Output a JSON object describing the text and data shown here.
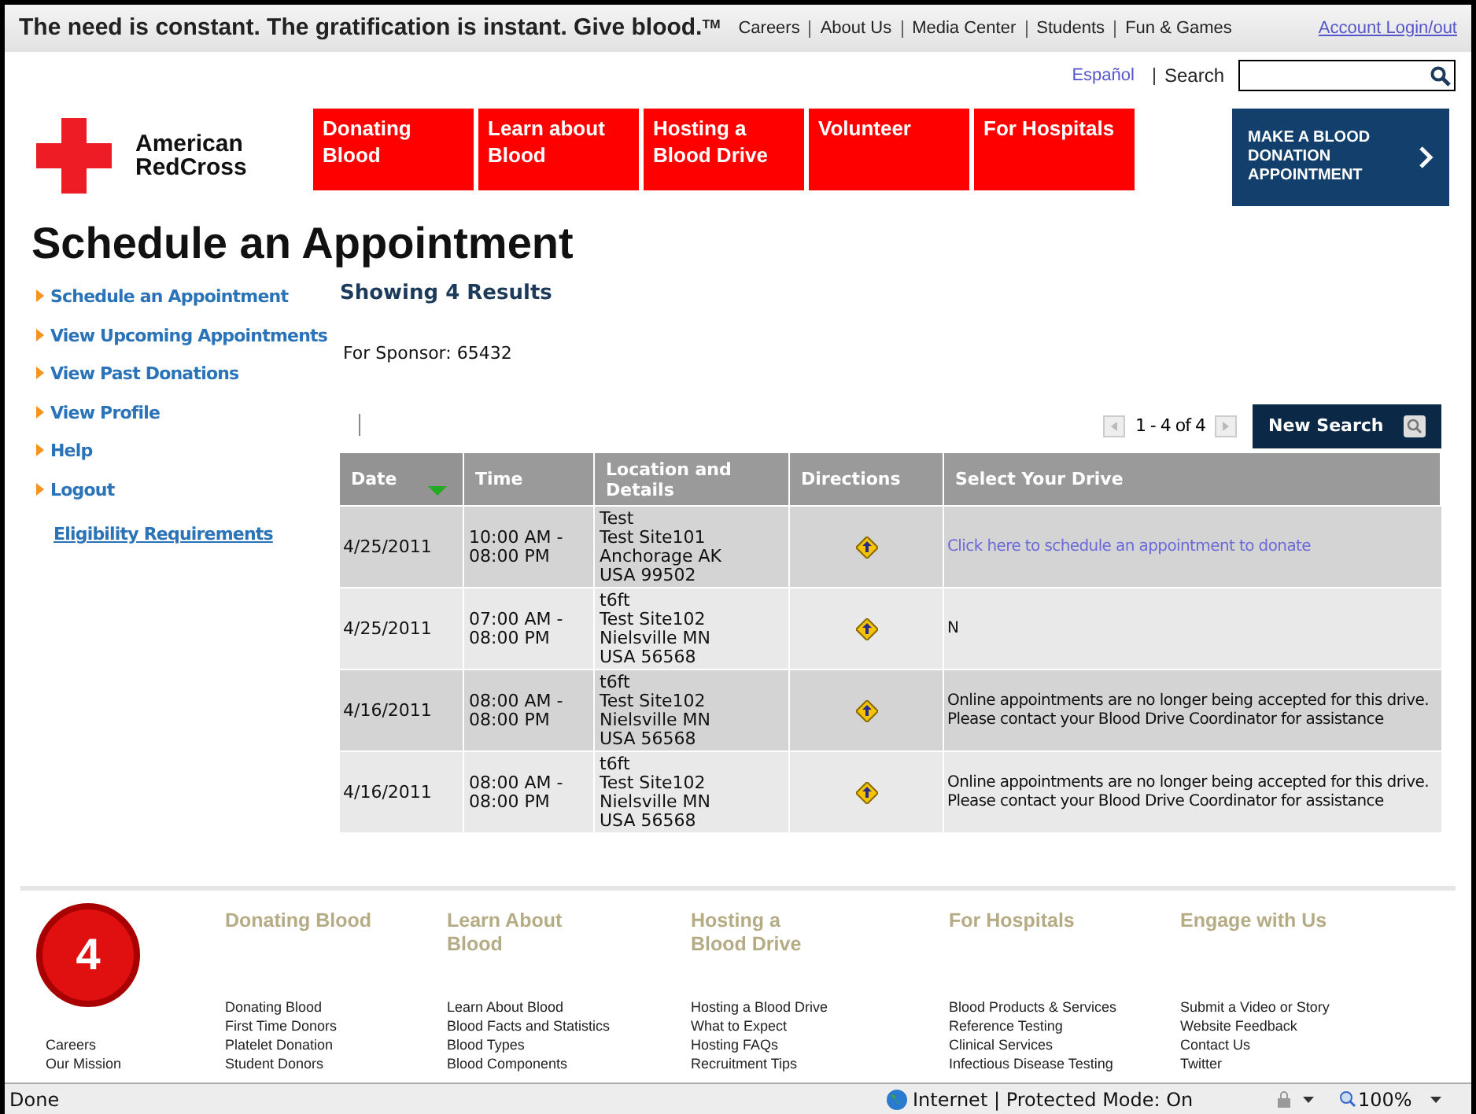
{
  "tagline": "The need is constant. The gratification is instant. Give blood.",
  "tagline_mark": "TM",
  "top_links": [
    "Careers",
    "About Us",
    "Media Center",
    "Students",
    "Fun & Games"
  ],
  "account_link": "Account Login/out",
  "language_link": "Español",
  "search": {
    "label": "Search"
  },
  "logo": {
    "line1": "American",
    "line2": "RedCross"
  },
  "nav": [
    {
      "line1": "Donating",
      "line2": "Blood"
    },
    {
      "line1": "Learn about",
      "line2": "Blood"
    },
    {
      "line1": "Hosting a",
      "line2": "Blood Drive"
    },
    {
      "line1": "Volunteer"
    },
    {
      "line1": "For Hospitals"
    }
  ],
  "cta": {
    "lines": [
      "MAKE A BLOOD",
      "DONATION",
      "APPOINTMENT"
    ]
  },
  "page_title": "Schedule an Appointment",
  "sidebar": {
    "items": [
      "Schedule an Appointment",
      "View Upcoming Appointments",
      "View Past Donations",
      "View Profile",
      "Help",
      "Logout"
    ],
    "eligibility_link": "Eligibility Requirements"
  },
  "results_heading": "Showing 4 Results",
  "sponsor": "For Sponsor: 65432",
  "pager": {
    "range": "1 - 4 of 4",
    "new_search": "New Search"
  },
  "table": {
    "columns": [
      {
        "label": "Date",
        "sorted": true
      },
      {
        "label": "Time",
        "sorted": false
      },
      {
        "label": "Location and Details",
        "sorted": false
      },
      {
        "label": "Directions",
        "sorted": false
      },
      {
        "label": "Select Your Drive",
        "sorted": false
      }
    ],
    "rows": [
      {
        "date": "4/25/2011",
        "time": [
          "10:00 AM -",
          "08:00 PM"
        ],
        "location": [
          "Test",
          "Test Site101",
          "Anchorage AK",
          "USA 99502"
        ],
        "drive": {
          "kind": "link",
          "lines": [
            "Click here to schedule an appointment to donate"
          ]
        }
      },
      {
        "date": "4/25/2011",
        "time": [
          "07:00 AM -",
          "08:00 PM"
        ],
        "location": [
          "t6ft",
          "Test Site102",
          "Nielsville MN",
          "USA 56568"
        ],
        "drive": {
          "kind": "text",
          "lines": [
            "N"
          ]
        }
      },
      {
        "date": "4/16/2011",
        "time": [
          "08:00 AM -",
          "08:00 PM"
        ],
        "location": [
          "t6ft",
          "Test Site102",
          "Nielsville MN",
          "USA 56568"
        ],
        "drive": {
          "kind": "text",
          "lines": [
            "Online appointments are no longer being accepted for this drive.",
            "Please contact your Blood Drive Coordinator for assistance"
          ]
        }
      },
      {
        "date": "4/16/2011",
        "time": [
          "08:00 AM -",
          "08:00 PM"
        ],
        "location": [
          "t6ft",
          "Test Site102",
          "Nielsville MN",
          "USA 56568"
        ],
        "drive": {
          "kind": "text",
          "lines": [
            "Online appointments are no longer being accepted for this drive.",
            "Please contact your Blood Drive Coordinator for assistance"
          ]
        }
      }
    ]
  },
  "footer": {
    "columns": [
      {
        "links": [
          "Careers",
          "Our Mission"
        ]
      },
      {
        "heading": [
          "Donating Blood"
        ],
        "links": [
          "Donating Blood",
          "First Time Donors",
          "Platelet Donation",
          "Student Donors"
        ]
      },
      {
        "heading": [
          "Learn About",
          "Blood"
        ],
        "links": [
          "Learn About Blood",
          "Blood Facts and Statistics",
          "Blood Types",
          "Blood Components"
        ]
      },
      {
        "heading": [
          "Hosting a",
          "Blood Drive"
        ],
        "links": [
          "Hosting a Blood Drive",
          "What to Expect",
          "Hosting FAQs",
          "Recruitment Tips"
        ]
      },
      {
        "heading": [
          "For Hospitals"
        ],
        "links": [
          "Blood Products & Services",
          "Reference Testing",
          "Clinical Services",
          "Infectious Disease Testing"
        ]
      },
      {
        "heading": [
          "Engage with Us"
        ],
        "links": [
          "Submit a Video or Story",
          "Website Feedback",
          "Contact Us",
          "Twitter"
        ]
      }
    ]
  },
  "badge": "4",
  "status_bar": {
    "text": "Done",
    "zone": "Internet | Protected Mode: On",
    "zoom": "100%"
  }
}
